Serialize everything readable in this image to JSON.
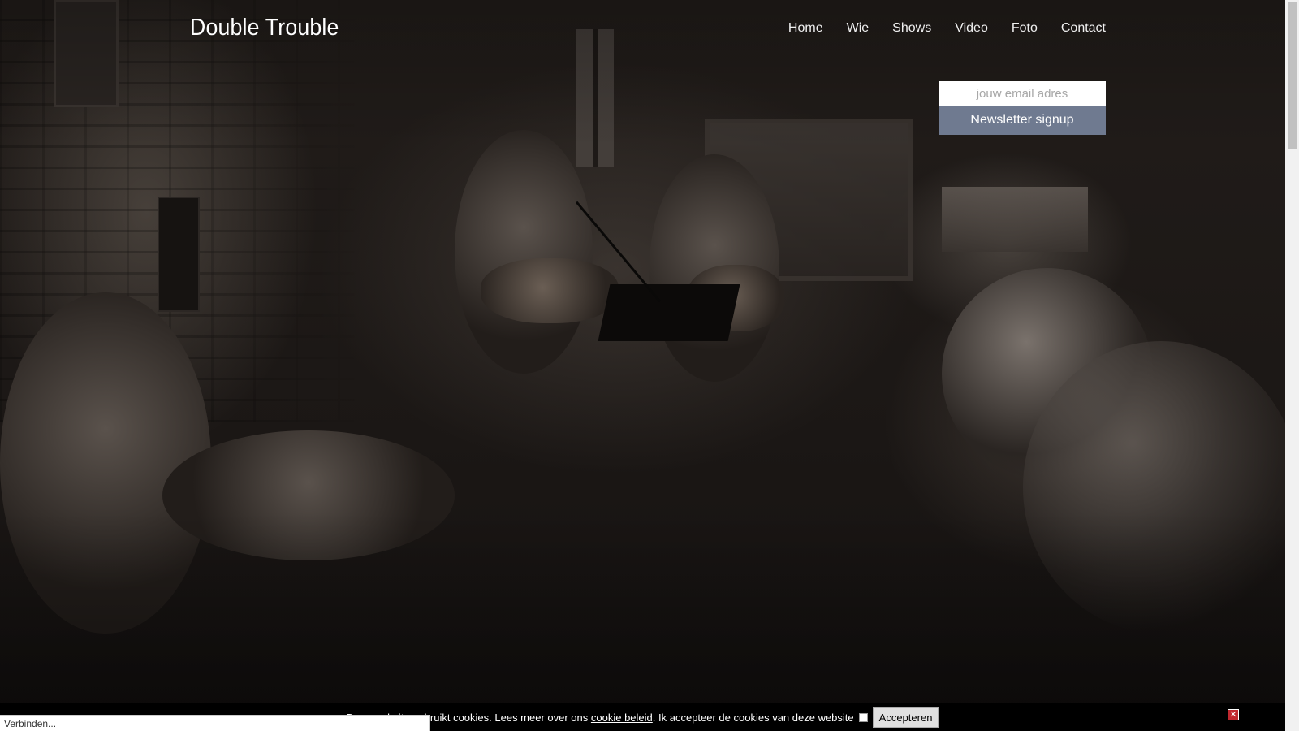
{
  "site": {
    "logo": "Double Trouble"
  },
  "nav": {
    "items": [
      "Home",
      "Wie",
      "Shows",
      "Video",
      "Foto",
      "Contact"
    ]
  },
  "newsletter": {
    "placeholder": "jouw email adres",
    "button_label": "Newsletter signup"
  },
  "cookie": {
    "message_before": "Deze website gebruikt cookies. Lees meer over ons ",
    "policy_link": "cookie beleid",
    "message_after": ". Ik accepteer de cookies van deze website",
    "accept_label": "Accepteren",
    "close_symbol": "✕"
  },
  "status_bar": {
    "text": "Verbinden..."
  },
  "colors": {
    "newsletter_button": "#6f7a90",
    "cookie_close": "#c0282f"
  }
}
